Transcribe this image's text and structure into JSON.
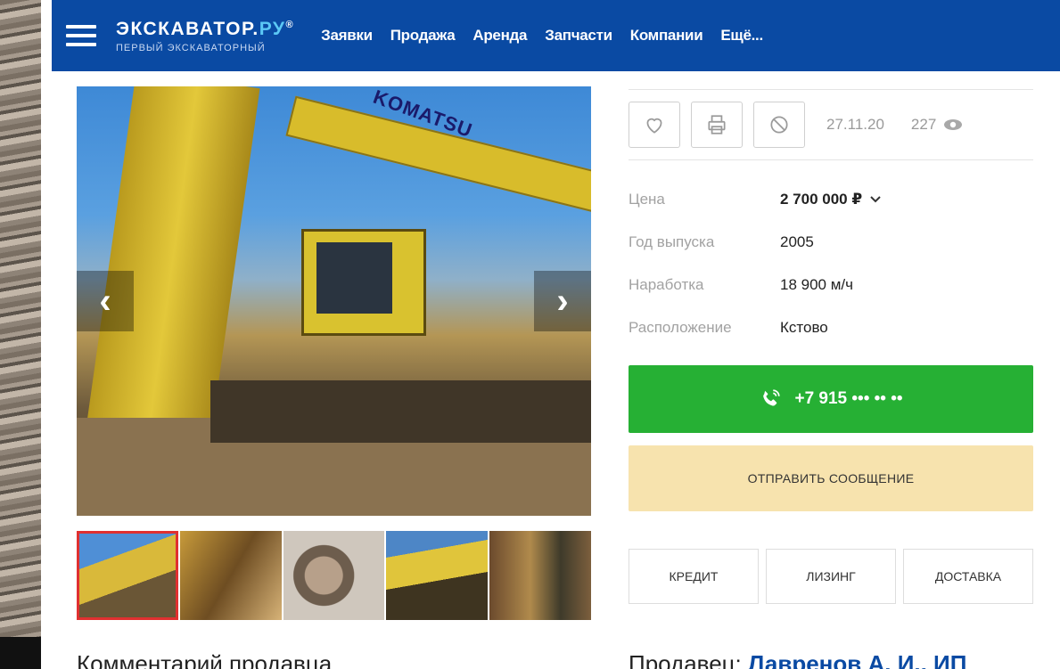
{
  "header": {
    "logo_main_a": "ЭКСКАВАТОР.",
    "logo_main_b": "РУ",
    "logo_reg": "®",
    "logo_sub": "ПЕРВЫЙ ЭКСКАВАТОРНЫЙ",
    "nav": [
      "Заявки",
      "Продажа",
      "Аренда",
      "Запчасти",
      "Компании",
      "Ещё..."
    ],
    "bg_color": "#0a4aa3"
  },
  "gallery": {
    "brand_text": "KOMATSU",
    "prev_icon": "chevron-left-icon",
    "next_icon": "chevron-right-icon",
    "thumbnail_count": 5,
    "active_thumbnail": 1
  },
  "listing": {
    "date": "27.11.20",
    "views": "227",
    "specs": [
      {
        "label": "Цена",
        "value": "2 700 000 ₽"
      },
      {
        "label": "Год выпуска",
        "value": "2005"
      },
      {
        "label": "Наработка",
        "value": "18 900 м/ч"
      },
      {
        "label": "Расположение",
        "value": "Кстово"
      }
    ]
  },
  "contact": {
    "phone": "+7 915 ••• •• ••",
    "phone_color": "#26b034",
    "message_button": "ОТПРАВИТЬ СООБЩЕНИЕ",
    "message_color": "#f7e3ae"
  },
  "extra_buttons": [
    "КРЕДИТ",
    "ЛИЗИНГ",
    "ДОСТАВКА"
  ],
  "footer": {
    "left_text": "Комментарий продавца",
    "right_prefix": "Продавец: ",
    "right_seller": "Лавренов А. И., ИП"
  }
}
